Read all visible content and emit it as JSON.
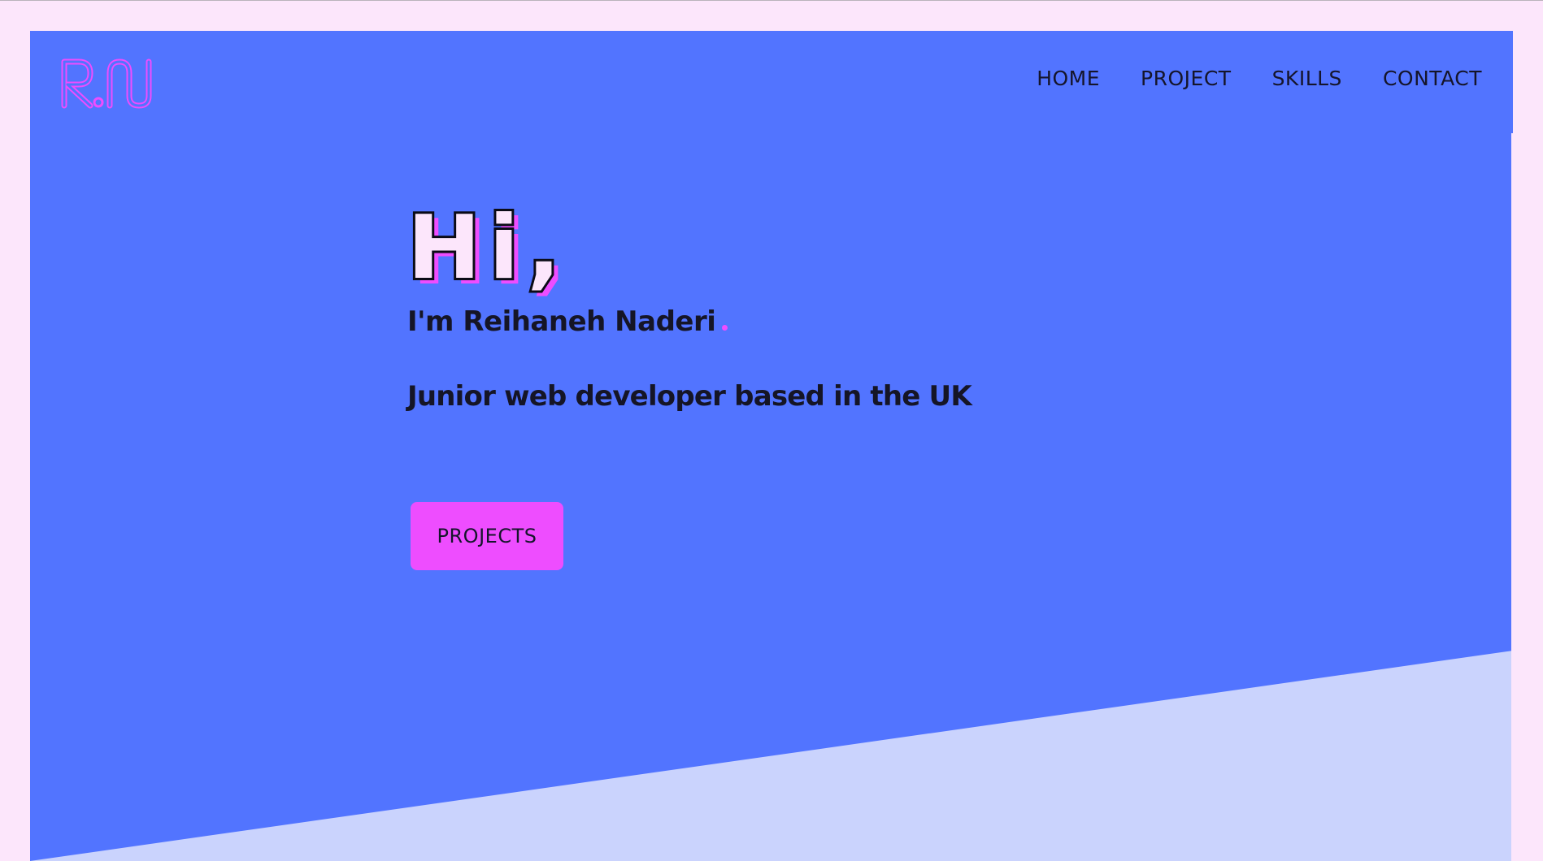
{
  "brand": {
    "logo_text": "RN"
  },
  "nav": {
    "items": [
      {
        "label": "HOME"
      },
      {
        "label": "PROJECT"
      },
      {
        "label": "SKILLS"
      },
      {
        "label": "CONTACT"
      }
    ]
  },
  "hero": {
    "greeting": "Hi,",
    "name": "I'm Reihaneh Naderi",
    "tagline": "Junior web developer based in the UK",
    "cta_label": "PROJECTS"
  },
  "colors": {
    "page_bg": "#fce6fb",
    "hero_bg": "#5274ff",
    "accent": "#ee4dff",
    "slant": "#cad3fd",
    "text": "#151526"
  }
}
